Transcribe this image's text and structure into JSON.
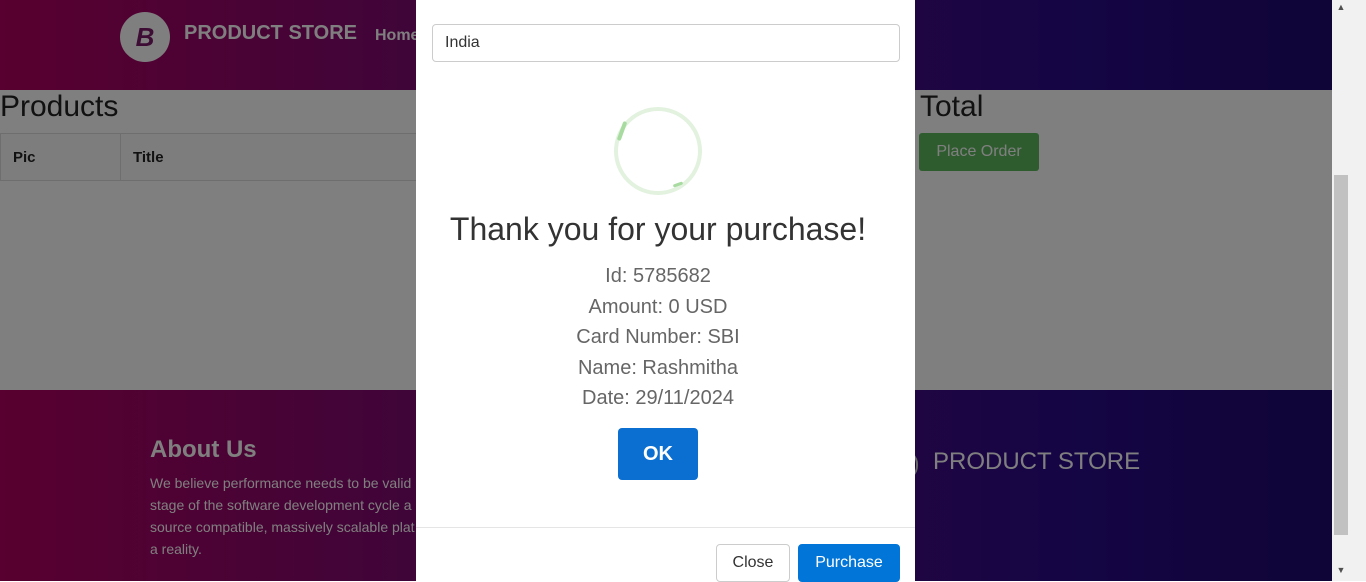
{
  "navbar": {
    "logo_letter": "B",
    "brand": "PRODUCT STORE",
    "home": "Home"
  },
  "cart": {
    "products_title": "Products",
    "total_title": "Total",
    "columns": [
      "Pic",
      "Title"
    ],
    "place_order": "Place Order"
  },
  "footer": {
    "about_title": "About Us",
    "about_text": "We believe performance needs to be valid stage of the software development cycle a source compatible, massively scalable plat a reality.",
    "brand": "PRODUCT STORE"
  },
  "order_modal": {
    "country_value": "India",
    "close_label": "Close",
    "purchase_label": "Purchase"
  },
  "alert": {
    "title": "Thank you for your purchase!",
    "id_line": "Id: 5785682",
    "amount_line": "Amount: 0 USD",
    "card_line": "Card Number: SBI",
    "name_line": "Name: Rashmitha",
    "date_line": "Date: 29/11/2024",
    "ok_label": "OK",
    "icon": "success-check-icon"
  },
  "scrollbar": {
    "up_glyph": "▲",
    "down_glyph": "▼"
  }
}
